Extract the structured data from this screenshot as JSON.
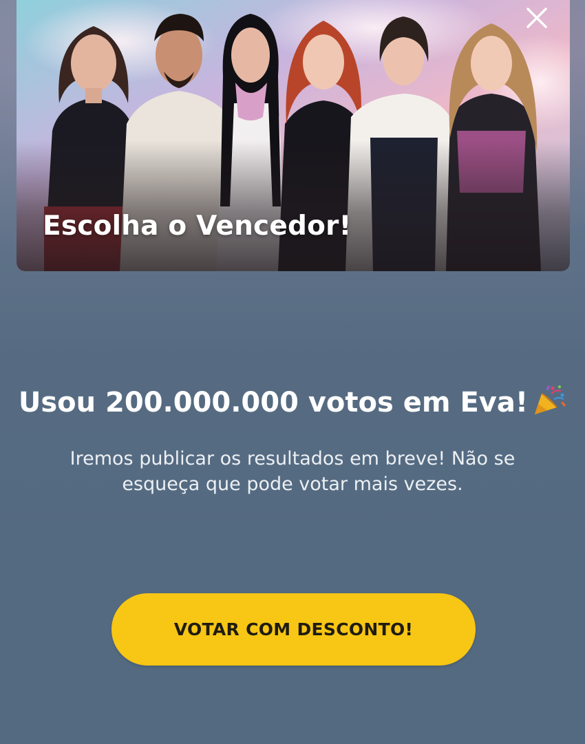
{
  "hero": {
    "title": "Escolha o Vencedor!",
    "close_icon": "close-icon"
  },
  "confirmation": {
    "headline": "Usou 200.000.000 votos em Eva!",
    "headline_icon": "party-popper-icon",
    "message": "Iremos publicar os resultados em breve! Não se esqueça que pode votar mais vezes."
  },
  "cta": {
    "label": "VOTAR COM DESCONTO!"
  },
  "colors": {
    "background": "#566c82",
    "button": "#f8c614",
    "button_text": "#1f1c12",
    "text": "#ffffff"
  }
}
